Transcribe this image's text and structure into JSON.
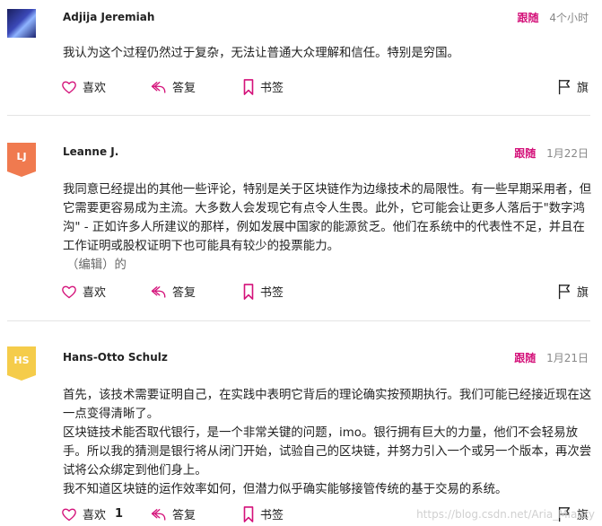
{
  "comments": [
    {
      "author": "Adjija Jeremiah",
      "follow": "跟随",
      "time": "4个小时",
      "avatar_initials": "",
      "paragraphs": [
        "我认为这个过程仍然过于复杂，无法让普通大众理解和信任。特别是穷国。"
      ],
      "edited": "",
      "actions": {
        "like": "喜欢",
        "like_count": "",
        "reply": "答复",
        "bookmark": "书签",
        "flag": "旗"
      }
    },
    {
      "author": "Leanne J.",
      "follow": "跟随",
      "time": "1月22日",
      "avatar_initials": "LJ",
      "paragraphs": [
        "我同意已经提出的其他一些评论，特别是关于区块链作为边缘技术的局限性。有一些早期采用者，但它需要更容易成为主流。大多数人会发现它有点令人生畏。此外，它可能会让更多人落后于\"数字鸿沟\" - 正如许多人所建议的那样，例如发展中国家的能源贫乏。他们在系统中的代表性不足，并且在工作证明或股权证明下也可能具有较少的投票能力。"
      ],
      "edited": "（编辑）的",
      "actions": {
        "like": "喜欢",
        "like_count": "",
        "reply": "答复",
        "bookmark": "书签",
        "flag": "旗"
      }
    },
    {
      "author": "Hans-Otto Schulz",
      "follow": "跟随",
      "time": "1月21日",
      "avatar_initials": "HS",
      "paragraphs": [
        "首先，该技术需要证明自己，在实践中表明它背后的理论确实按预期执行。我们可能已经接近现在这一点变得清晰了。",
        "区块链技术能否取代银行，是一个非常关键的问题，imo。银行拥有巨大的力量，他们不会轻易放手。所以我的猜测是银行将从闭门开始，试验自己的区块链，并努力引入一个或另一个版本，再次尝试将公众绑定到他们身上。",
        "我不知道区块链的运作效率如何，但潜力似乎确实能够接管传统的基于交易的系统。"
      ],
      "edited": "",
      "actions": {
        "like": "喜欢",
        "like_count": "1",
        "reply": "答复",
        "bookmark": "书签",
        "flag": "旗"
      }
    }
  ],
  "watermark": "https://blog.csdn.net/Aria_Miazzy",
  "colors": {
    "accent": "#d4127a",
    "lj_badge": "#f07a4f",
    "hs_badge": "#f5cc4a"
  }
}
